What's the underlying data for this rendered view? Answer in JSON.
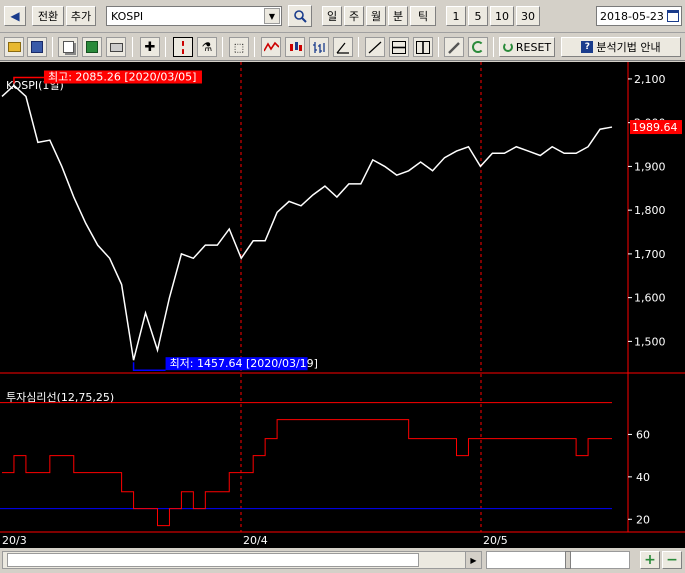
{
  "toolbar": {
    "back_icon": "back-arrow-icon",
    "convert_label": "전환",
    "add_label": "추가",
    "symbol_value": "KOSPI",
    "periods": [
      "일",
      "주",
      "월",
      "분",
      "틱"
    ],
    "counts": [
      "1",
      "5",
      "10",
      "30"
    ],
    "date_value": "2018-05-23",
    "reset_label": "RESET",
    "guide_label": "분석기법 안내"
  },
  "colors": {
    "price_line": "#ffffff",
    "indicator_line": "#ff0000",
    "high_marker": "#ff0000",
    "low_marker": "#0000ff",
    "grid_divider": "#ff0000",
    "lower_band": "#0000ff"
  },
  "chart_data": [
    {
      "type": "line",
      "title": "KOSPI(1일)",
      "x_ticks": [
        "20/3",
        "20/4",
        "20/5"
      ],
      "y_ticks": [
        1500,
        1600,
        1700,
        1800,
        1900,
        2000,
        2100
      ],
      "ylim": [
        1430,
        2125
      ],
      "last_value_label": "1989.64",
      "high_label": "최고: 2085.26 [2020/03/05]",
      "low_label": "최저: 1457.64 [2020/03/19]",
      "values": [
        2060,
        2085,
        2060,
        1955,
        1960,
        1900,
        1830,
        1770,
        1720,
        1690,
        1630,
        1457,
        1565,
        1480,
        1600,
        1700,
        1690,
        1720,
        1720,
        1757,
        1690,
        1730,
        1730,
        1795,
        1820,
        1810,
        1835,
        1855,
        1830,
        1860,
        1860,
        1915,
        1900,
        1880,
        1890,
        1910,
        1890,
        1920,
        1935,
        1945,
        1900,
        1930,
        1930,
        1945,
        1935,
        1925,
        1945,
        1930,
        1930,
        1945,
        1985,
        1990
      ]
    },
    {
      "type": "line",
      "title": "투자심리선(12,75,25)",
      "y_ticks": [
        20,
        40,
        60
      ],
      "ylim": [
        14,
        80
      ],
      "upper_band": 75,
      "lower_band": 25,
      "values": [
        42,
        50,
        42,
        42,
        50,
        50,
        42,
        42,
        42,
        42,
        33,
        25,
        25,
        17,
        25,
        33,
        25,
        33,
        33,
        42,
        42,
        50,
        58,
        67,
        67,
        67,
        67,
        67,
        67,
        67,
        67,
        67,
        67,
        67,
        58,
        58,
        58,
        58,
        50,
        58,
        58,
        58,
        58,
        58,
        58,
        58,
        58,
        58,
        50,
        58,
        58,
        58
      ]
    }
  ]
}
